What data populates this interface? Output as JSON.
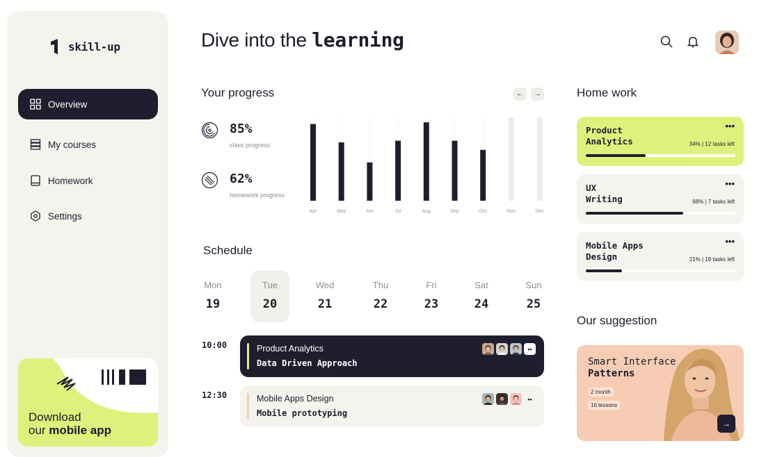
{
  "app": {
    "logo_text": "skill-up"
  },
  "sidebar": {
    "items": [
      {
        "label": "Overview"
      },
      {
        "label": "My courses"
      },
      {
        "label": "Homework"
      },
      {
        "label": "Settings"
      }
    ]
  },
  "promo": {
    "line1": "Download",
    "line2_prefix": "our ",
    "line2_bold": "mobile app"
  },
  "header": {
    "title_prefix": "Dive into the ",
    "title_bold": "learning"
  },
  "progress": {
    "title": "Your progress",
    "prev_label": "←",
    "next_label": "→",
    "stats": [
      {
        "value": "85%",
        "label": "class progress"
      },
      {
        "value": "62%",
        "label": "homework progress"
      }
    ]
  },
  "chart_data": {
    "type": "bar",
    "categories": [
      "Apr",
      "May",
      "Jun",
      "Jul",
      "Aug",
      "Sep",
      "Oct",
      "Nov",
      "Dec"
    ],
    "values": [
      92,
      70,
      46,
      72,
      94,
      72,
      61,
      0,
      0
    ],
    "ylim": [
      0,
      100
    ],
    "future_months": [
      "Nov",
      "Dec"
    ],
    "colors": {
      "bar": "#1e1e2e",
      "future": "#ececec"
    }
  },
  "schedule": {
    "title": "Schedule",
    "days": [
      {
        "name": "Mon",
        "num": "19"
      },
      {
        "name": "Tue",
        "num": "20"
      },
      {
        "name": "Wed",
        "num": "21"
      },
      {
        "name": "Thu",
        "num": "22"
      },
      {
        "name": "Fri",
        "num": "23"
      },
      {
        "name": "Sat",
        "num": "24"
      },
      {
        "name": "Sun",
        "num": "25"
      }
    ],
    "selected_day": "Tue",
    "events": [
      {
        "time": "10:00",
        "title": "Product Analytics",
        "subtitle": "Data Driven Approach",
        "more": "••",
        "accent": "#dff17c"
      },
      {
        "time": "12:30",
        "title": "Mobile Apps Design",
        "subtitle": "Mobile prototyping",
        "more": "••",
        "accent": "#f6cdb4"
      }
    ]
  },
  "homework": {
    "title": "Home work",
    "cards": [
      {
        "line1": "Product",
        "line2": "Analytics",
        "meta": "34% | 12 tasks left",
        "progress": 0.4,
        "bg": "#dff17c",
        "dots": "•••"
      },
      {
        "line1": "UX",
        "line2": "Writing",
        "meta": "68% | 7 tasks left",
        "progress": 0.65,
        "bg": "#f4f3ee",
        "dots": "•••"
      },
      {
        "line1": "Mobile Apps",
        "line2": "Design",
        "meta": "21% | 18 tasks left",
        "progress": 0.24,
        "bg": "#f4f3ee",
        "dots": "•••"
      }
    ]
  },
  "suggestion": {
    "title": "Our suggestion",
    "card_line1": "Smart Interface",
    "card_line2": "Patterns",
    "duration": "2 month",
    "lessons": "16 lessons",
    "action": "→"
  },
  "colors": {
    "lime": "#dff17c",
    "peach": "#f6cdb4",
    "dark": "#1e1e2e",
    "panel": "#f4f3ee"
  }
}
